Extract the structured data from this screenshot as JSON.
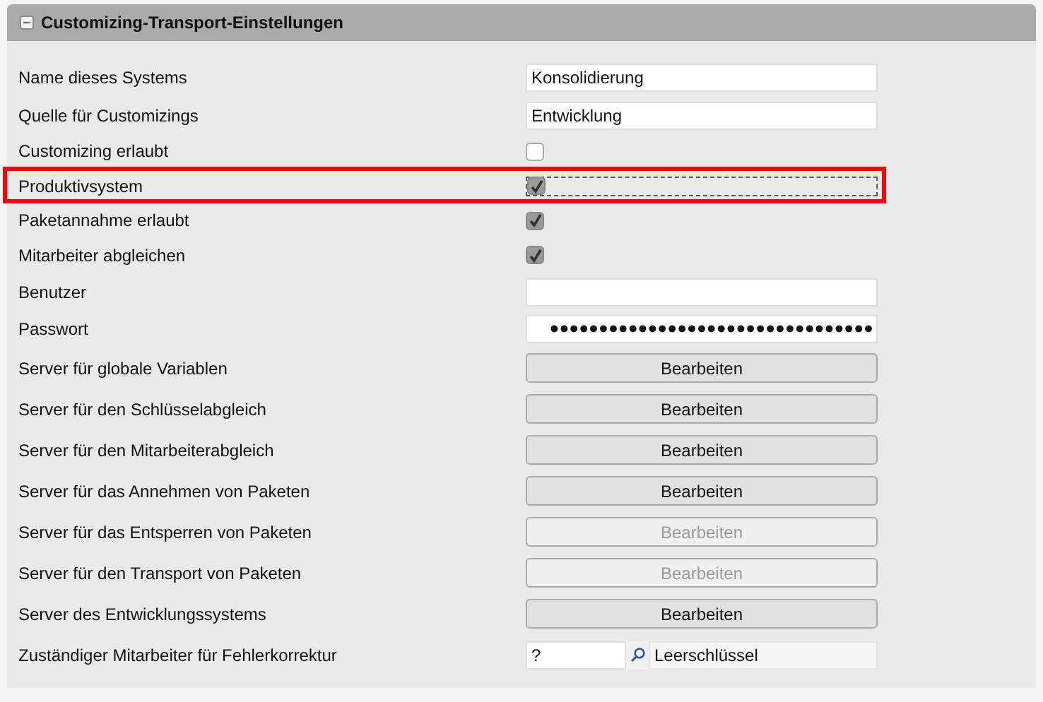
{
  "panel": {
    "title": "Customizing-Transport-Einstellungen",
    "expanded": true
  },
  "rows": [
    {
      "kind": "text",
      "label": "Name dieses Systems",
      "value": "Konsolidierung"
    },
    {
      "kind": "text",
      "label": "Quelle für Customizings",
      "value": "Entwicklung"
    },
    {
      "kind": "checkbox",
      "label": "Customizing erlaubt",
      "checked": false,
      "focused": false,
      "highlighted": false
    },
    {
      "kind": "checkbox",
      "label": "Produktivsystem",
      "checked": true,
      "focused": true,
      "highlighted": true
    },
    {
      "kind": "checkbox",
      "label": "Paketannahme erlaubt",
      "checked": true,
      "focused": false,
      "highlighted": false
    },
    {
      "kind": "checkbox",
      "label": "Mitarbeiter abgleichen",
      "checked": true,
      "focused": false,
      "highlighted": false
    },
    {
      "kind": "text",
      "label": "Benutzer",
      "value": ""
    },
    {
      "kind": "password",
      "label": "Passwort",
      "value": "●●●●●●●●●●●●●●●●●●●●●●●●●●●●●●●●●"
    },
    {
      "kind": "button",
      "label": "Server für globale Variablen",
      "button": "Bearbeiten",
      "disabled": false
    },
    {
      "kind": "button",
      "label": "Server für den Schlüsselabgleich",
      "button": "Bearbeiten",
      "disabled": false
    },
    {
      "kind": "button",
      "label": "Server für den Mitarbeiterabgleich",
      "button": "Bearbeiten",
      "disabled": false
    },
    {
      "kind": "button",
      "label": "Server für das Annehmen von Paketen",
      "button": "Bearbeiten",
      "disabled": false
    },
    {
      "kind": "button",
      "label": "Server für das Entsperren von Paketen",
      "button": "Bearbeiten",
      "disabled": true
    },
    {
      "kind": "button",
      "label": "Server für den Transport von Paketen",
      "button": "Bearbeiten",
      "disabled": true
    },
    {
      "kind": "button",
      "label": "Server des Entwicklungssystems",
      "button": "Bearbeiten",
      "disabled": false
    },
    {
      "kind": "lookup",
      "label": "Zuständiger Mitarbeiter für Fehlerkorrektur",
      "value": "?",
      "description": "Leerschlüssel"
    }
  ]
}
